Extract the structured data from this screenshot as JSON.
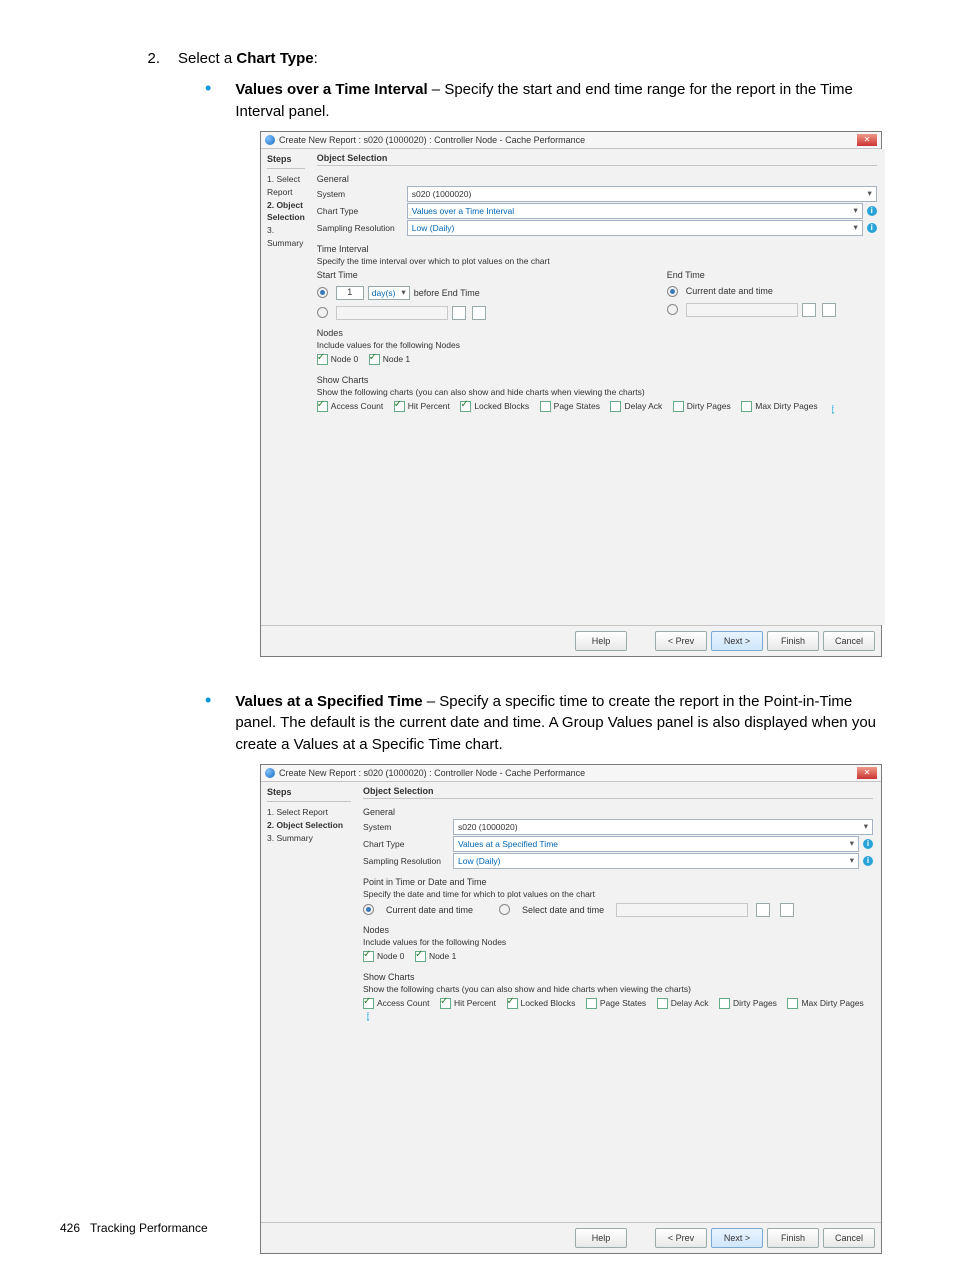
{
  "document": {
    "step_number": "2.",
    "step_text_prefix": "Select a ",
    "step_text_bold": "Chart Type",
    "step_text_suffix": ":",
    "bullet1_bold": "Values over a Time Interval",
    "bullet1_rest": " – Specify the start and end time range for the report in the Time Interval panel.",
    "bullet2_bold": "Values at a Specified Time",
    "bullet2_rest": " – Specify a specific time to create the report in the Point-in-Time panel. The default is the current date and time. A Group Values panel is also displayed when you create a Values at a Specific Time chart.",
    "footer_page": "426",
    "footer_section": "Tracking Performance"
  },
  "wizard": {
    "title": "Create New Report : s020 (1000020) : Controller Node - Cache Performance",
    "steps_header": "Steps",
    "panel_header": "Object Selection",
    "steps": [
      "1. Select Report",
      "2. Object Selection",
      "3. Summary"
    ],
    "general": {
      "label": "General",
      "system_label": "System",
      "system_value": "s020 (1000020)",
      "chart_type_label": "Chart Type",
      "sampling_label": "Sampling Resolution",
      "sampling_value": "Low (Daily)"
    },
    "buttons": {
      "help": "Help",
      "prev": "< Prev",
      "next": "Next >",
      "finish": "Finish",
      "cancel": "Cancel"
    },
    "nodes": {
      "label": "Nodes",
      "desc": "Include values for the following Nodes",
      "items": [
        "Node 0",
        "Node 1"
      ]
    },
    "charts": {
      "label": "Show Charts",
      "desc": "Show the following charts (you can also show and hide charts when viewing the charts)",
      "items": [
        {
          "label": "Access Count",
          "on": true
        },
        {
          "label": "Hit Percent",
          "on": true
        },
        {
          "label": "Locked Blocks",
          "on": true
        },
        {
          "label": "Page States",
          "on": false
        },
        {
          "label": "Delay Ack",
          "on": false
        },
        {
          "label": "Dirty Pages",
          "on": false
        },
        {
          "label": "Max Dirty Pages",
          "on": false
        }
      ]
    }
  },
  "shot1": {
    "chart_type_value": "Values over a Time Interval",
    "time_interval": {
      "label": "Time Interval",
      "desc": "Specify the time interval over which to plot values on the chart",
      "start_label": "Start Time",
      "end_label": "End Time",
      "relative_value": "1",
      "relative_unit": "day(s)",
      "relative_suffix": "before End Time",
      "current_label": "Current date and time"
    }
  },
  "shot2": {
    "chart_type_value": "Values at a Specified Time",
    "pit": {
      "label": "Point in Time or Date and Time",
      "desc": "Specify the date and time for which to plot values on the chart",
      "current": "Current date and time",
      "select": "Select date and time"
    }
  }
}
